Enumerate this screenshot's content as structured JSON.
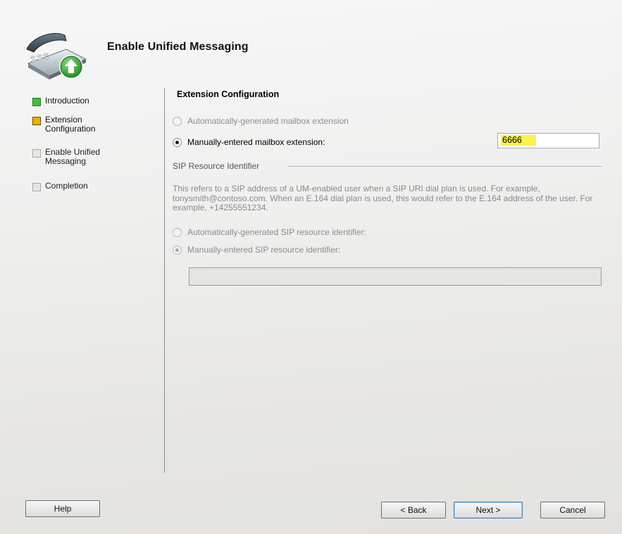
{
  "header": {
    "title": "Enable Unified Messaging",
    "icon": "phone-with-green-arrow-icon"
  },
  "steps": [
    {
      "label": "Introduction",
      "state": "done"
    },
    {
      "label": "Extension Configuration",
      "state": "current"
    },
    {
      "label": "Enable Unified Messaging",
      "state": "pending"
    },
    {
      "label": "Completion",
      "state": "pending"
    }
  ],
  "content": {
    "section_title": "Extension Configuration",
    "radio_auto_extension": "Automatically-generated mailbox extension",
    "radio_manual_extension": "Manually-entered mailbox extension:",
    "extension_value": "6666",
    "sip_group_label": "SIP Resource Identifier",
    "sip_description": "This refers to a SIP address of a UM-enabled user when a SIP URI dial plan is used. For example, tonysmith@contoso.com. When an E.164 dial plan is used, this would refer to the E.164 address of the user. For example, +14255551234.",
    "radio_auto_sip": "Automatically-generated SIP resource identifier:",
    "radio_manual_sip": "Manually-entered SIP resource identifier:",
    "sip_value": ""
  },
  "buttons": {
    "help": "Help",
    "back": "< Back",
    "next": "Next >",
    "cancel": "Cancel"
  },
  "colors": {
    "done": "#3fbf3f",
    "current": "#e9b100",
    "highlight": "#fbf24a"
  }
}
